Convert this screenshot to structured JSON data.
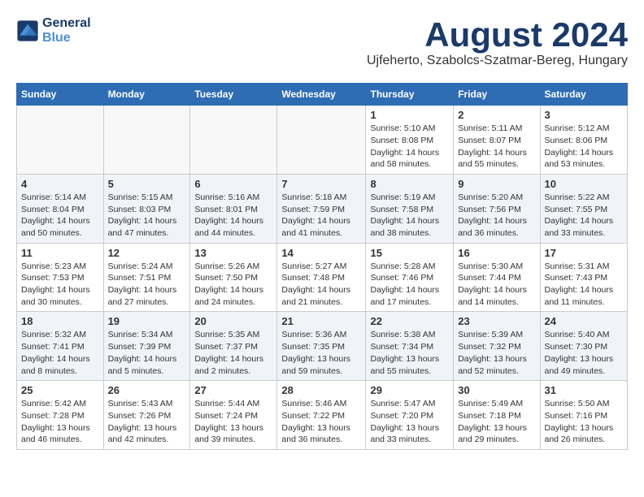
{
  "header": {
    "logo_line1": "General",
    "logo_line2": "Blue",
    "month_title": "August 2024",
    "subtitle": "Ujfeherto, Szabolcs-Szatmar-Bereg, Hungary"
  },
  "weekdays": [
    "Sunday",
    "Monday",
    "Tuesday",
    "Wednesday",
    "Thursday",
    "Friday",
    "Saturday"
  ],
  "weeks": [
    [
      {
        "date": "",
        "info": ""
      },
      {
        "date": "",
        "info": ""
      },
      {
        "date": "",
        "info": ""
      },
      {
        "date": "",
        "info": ""
      },
      {
        "date": "1",
        "info": "Sunrise: 5:10 AM\nSunset: 8:08 PM\nDaylight: 14 hours\nand 58 minutes."
      },
      {
        "date": "2",
        "info": "Sunrise: 5:11 AM\nSunset: 8:07 PM\nDaylight: 14 hours\nand 55 minutes."
      },
      {
        "date": "3",
        "info": "Sunrise: 5:12 AM\nSunset: 8:06 PM\nDaylight: 14 hours\nand 53 minutes."
      }
    ],
    [
      {
        "date": "4",
        "info": "Sunrise: 5:14 AM\nSunset: 8:04 PM\nDaylight: 14 hours\nand 50 minutes."
      },
      {
        "date": "5",
        "info": "Sunrise: 5:15 AM\nSunset: 8:03 PM\nDaylight: 14 hours\nand 47 minutes."
      },
      {
        "date": "6",
        "info": "Sunrise: 5:16 AM\nSunset: 8:01 PM\nDaylight: 14 hours\nand 44 minutes."
      },
      {
        "date": "7",
        "info": "Sunrise: 5:18 AM\nSunset: 7:59 PM\nDaylight: 14 hours\nand 41 minutes."
      },
      {
        "date": "8",
        "info": "Sunrise: 5:19 AM\nSunset: 7:58 PM\nDaylight: 14 hours\nand 38 minutes."
      },
      {
        "date": "9",
        "info": "Sunrise: 5:20 AM\nSunset: 7:56 PM\nDaylight: 14 hours\nand 36 minutes."
      },
      {
        "date": "10",
        "info": "Sunrise: 5:22 AM\nSunset: 7:55 PM\nDaylight: 14 hours\nand 33 minutes."
      }
    ],
    [
      {
        "date": "11",
        "info": "Sunrise: 5:23 AM\nSunset: 7:53 PM\nDaylight: 14 hours\nand 30 minutes."
      },
      {
        "date": "12",
        "info": "Sunrise: 5:24 AM\nSunset: 7:51 PM\nDaylight: 14 hours\nand 27 minutes."
      },
      {
        "date": "13",
        "info": "Sunrise: 5:26 AM\nSunset: 7:50 PM\nDaylight: 14 hours\nand 24 minutes."
      },
      {
        "date": "14",
        "info": "Sunrise: 5:27 AM\nSunset: 7:48 PM\nDaylight: 14 hours\nand 21 minutes."
      },
      {
        "date": "15",
        "info": "Sunrise: 5:28 AM\nSunset: 7:46 PM\nDaylight: 14 hours\nand 17 minutes."
      },
      {
        "date": "16",
        "info": "Sunrise: 5:30 AM\nSunset: 7:44 PM\nDaylight: 14 hours\nand 14 minutes."
      },
      {
        "date": "17",
        "info": "Sunrise: 5:31 AM\nSunset: 7:43 PM\nDaylight: 14 hours\nand 11 minutes."
      }
    ],
    [
      {
        "date": "18",
        "info": "Sunrise: 5:32 AM\nSunset: 7:41 PM\nDaylight: 14 hours\nand 8 minutes."
      },
      {
        "date": "19",
        "info": "Sunrise: 5:34 AM\nSunset: 7:39 PM\nDaylight: 14 hours\nand 5 minutes."
      },
      {
        "date": "20",
        "info": "Sunrise: 5:35 AM\nSunset: 7:37 PM\nDaylight: 14 hours\nand 2 minutes."
      },
      {
        "date": "21",
        "info": "Sunrise: 5:36 AM\nSunset: 7:35 PM\nDaylight: 13 hours\nand 59 minutes."
      },
      {
        "date": "22",
        "info": "Sunrise: 5:38 AM\nSunset: 7:34 PM\nDaylight: 13 hours\nand 55 minutes."
      },
      {
        "date": "23",
        "info": "Sunrise: 5:39 AM\nSunset: 7:32 PM\nDaylight: 13 hours\nand 52 minutes."
      },
      {
        "date": "24",
        "info": "Sunrise: 5:40 AM\nSunset: 7:30 PM\nDaylight: 13 hours\nand 49 minutes."
      }
    ],
    [
      {
        "date": "25",
        "info": "Sunrise: 5:42 AM\nSunset: 7:28 PM\nDaylight: 13 hours\nand 46 minutes."
      },
      {
        "date": "26",
        "info": "Sunrise: 5:43 AM\nSunset: 7:26 PM\nDaylight: 13 hours\nand 42 minutes."
      },
      {
        "date": "27",
        "info": "Sunrise: 5:44 AM\nSunset: 7:24 PM\nDaylight: 13 hours\nand 39 minutes."
      },
      {
        "date": "28",
        "info": "Sunrise: 5:46 AM\nSunset: 7:22 PM\nDaylight: 13 hours\nand 36 minutes."
      },
      {
        "date": "29",
        "info": "Sunrise: 5:47 AM\nSunset: 7:20 PM\nDaylight: 13 hours\nand 33 minutes."
      },
      {
        "date": "30",
        "info": "Sunrise: 5:49 AM\nSunset: 7:18 PM\nDaylight: 13 hours\nand 29 minutes."
      },
      {
        "date": "31",
        "info": "Sunrise: 5:50 AM\nSunset: 7:16 PM\nDaylight: 13 hours\nand 26 minutes."
      }
    ]
  ]
}
